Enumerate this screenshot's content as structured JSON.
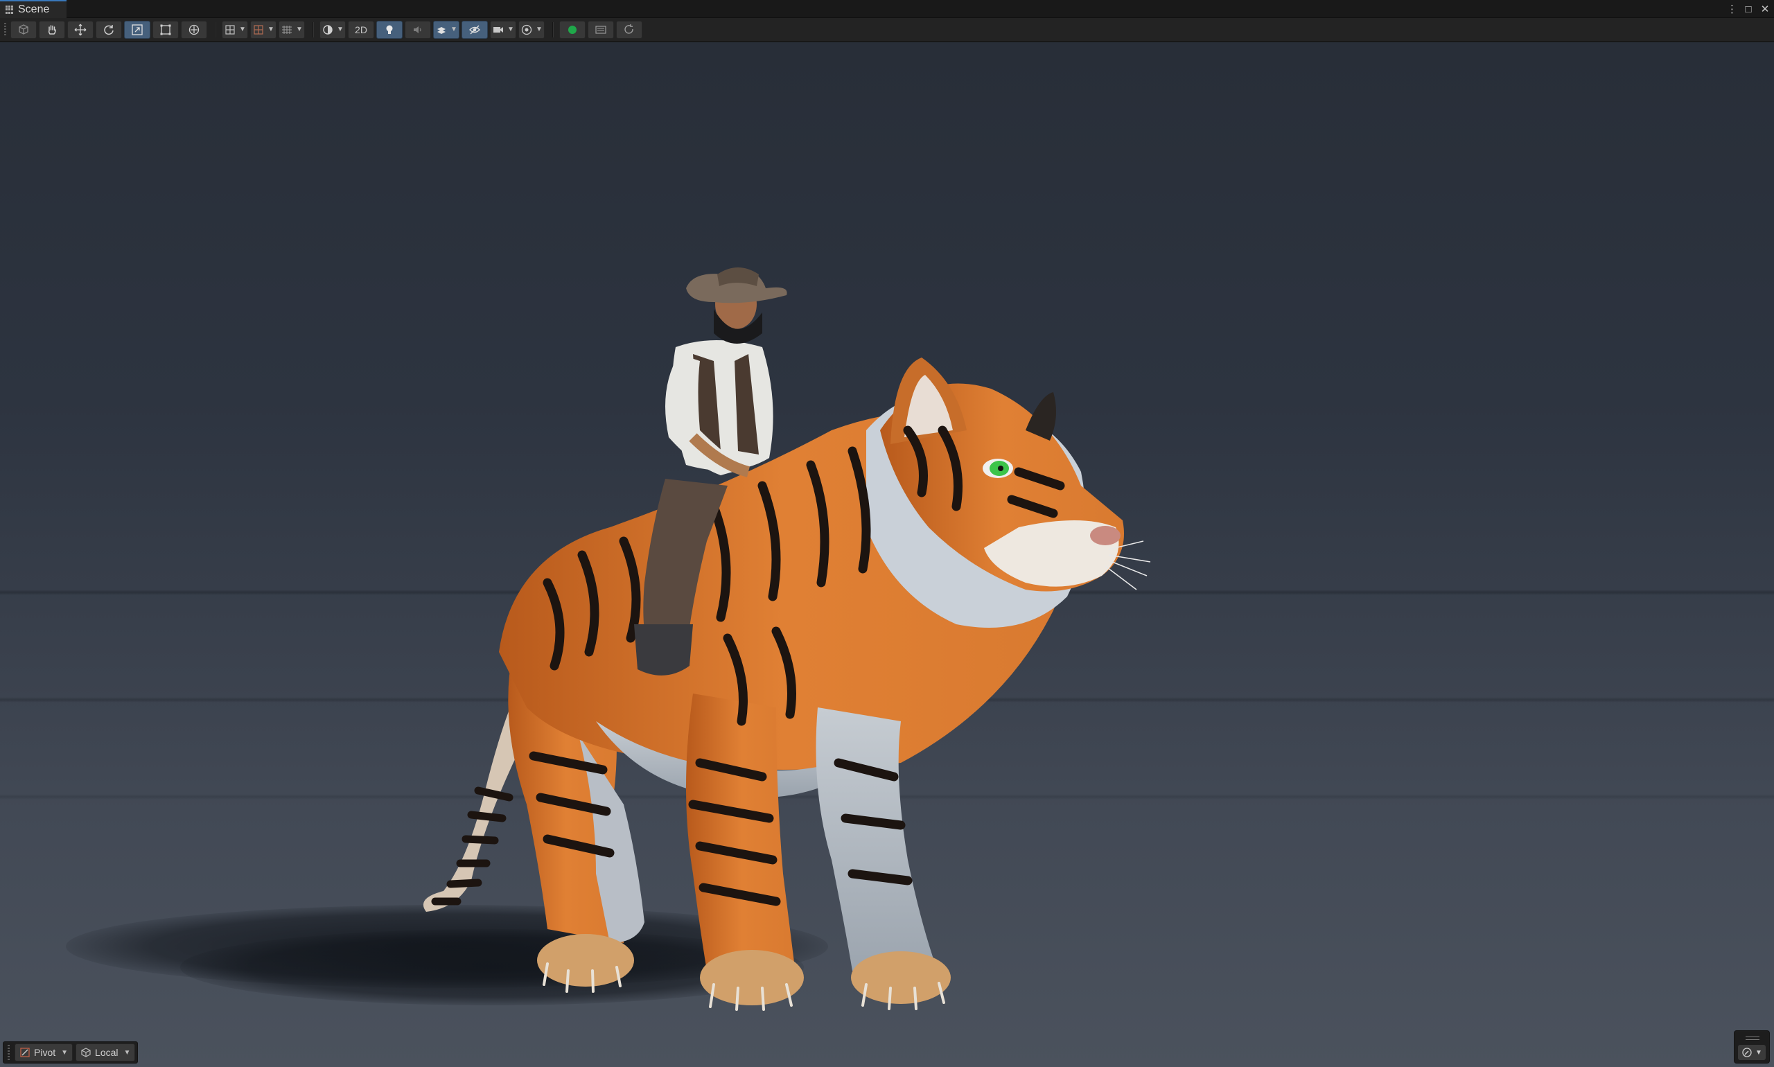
{
  "window": {
    "tab_label": "Scene",
    "controls": {
      "menu": "⋮",
      "maximize": "□",
      "close": "✕"
    }
  },
  "toolbar": {
    "tools": [
      {
        "name": "view-tool",
        "icon": "cube-icon"
      },
      {
        "name": "hand-tool",
        "icon": "hand-icon"
      },
      {
        "name": "move-tool",
        "icon": "move-arrows-icon"
      },
      {
        "name": "rotate-tool",
        "icon": "rotate-icon"
      },
      {
        "name": "scale-tool",
        "icon": "scale-icon",
        "active": true
      },
      {
        "name": "rect-tool",
        "icon": "rect-icon"
      },
      {
        "name": "transform-tool",
        "icon": "transform-icon"
      }
    ],
    "mode_2d_label": "2D",
    "playmode_color": "#1fa84a"
  },
  "bottom_bar": {
    "pivot_label": "Pivot",
    "local_label": "Local"
  },
  "scene": {
    "background_top": "#282e38",
    "background_bottom": "#4b525d",
    "tiger_color": "#d8742a",
    "tiger_eye_color": "#3cc44a"
  }
}
